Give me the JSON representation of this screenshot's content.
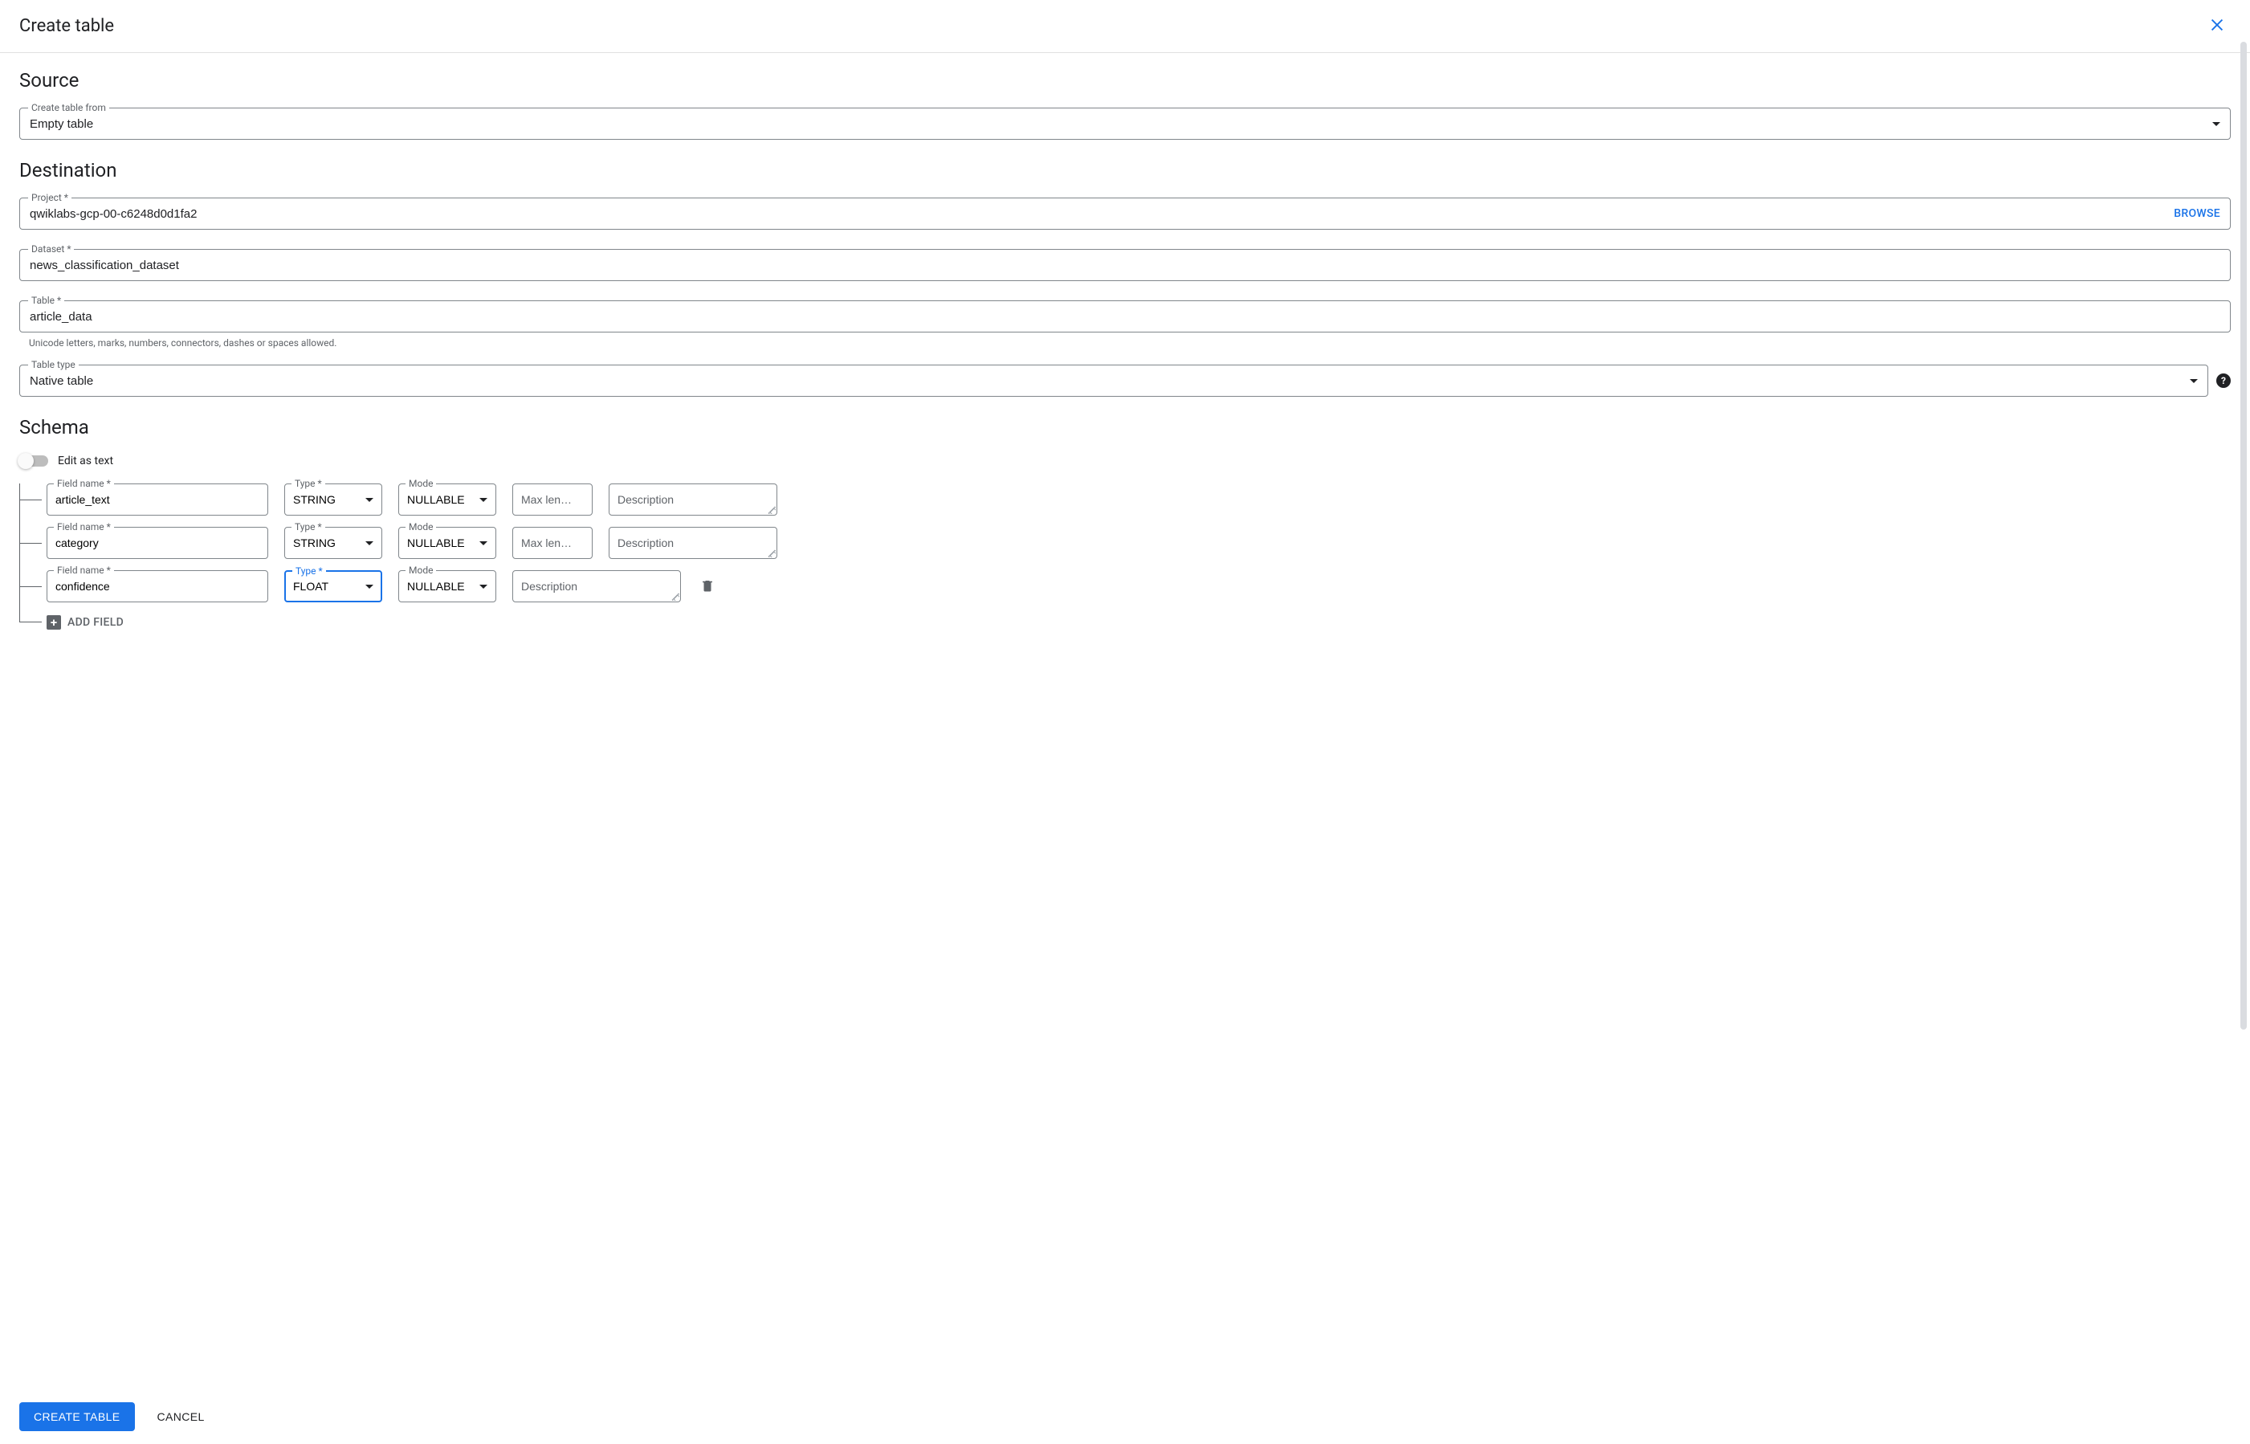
{
  "header": {
    "title": "Create table"
  },
  "source": {
    "title": "Source",
    "create_from_label": "Create table from",
    "create_from_value": "Empty table"
  },
  "destination": {
    "title": "Destination",
    "project_label": "Project *",
    "project_value": "qwiklabs-gcp-00-c6248d0d1fa2",
    "browse_label": "BROWSE",
    "dataset_label": "Dataset *",
    "dataset_value": "news_classification_dataset",
    "table_label": "Table *",
    "table_value": "article_data",
    "table_hint": "Unicode letters, marks, numbers, connectors, dashes or spaces allowed.",
    "table_type_label": "Table type",
    "table_type_value": "Native table"
  },
  "schema": {
    "title": "Schema",
    "edit_as_text_label": "Edit as text",
    "field_name_label": "Field name *",
    "type_label": "Type *",
    "mode_label": "Mode",
    "maxlen_placeholder": "Max len…",
    "desc_placeholder": "Description",
    "fields": [
      {
        "name": "article_text",
        "type": "STRING",
        "mode": "NULLABLE",
        "has_maxlen": true,
        "type_focused": false,
        "show_delete": false
      },
      {
        "name": "category",
        "type": "STRING",
        "mode": "NULLABLE",
        "has_maxlen": true,
        "type_focused": false,
        "show_delete": false
      },
      {
        "name": "confidence",
        "type": "FLOAT",
        "mode": "NULLABLE",
        "has_maxlen": false,
        "type_focused": true,
        "show_delete": true
      }
    ],
    "add_field_label": "ADD FIELD"
  },
  "footer": {
    "create_label": "CREATE TABLE",
    "cancel_label": "CANCEL"
  }
}
